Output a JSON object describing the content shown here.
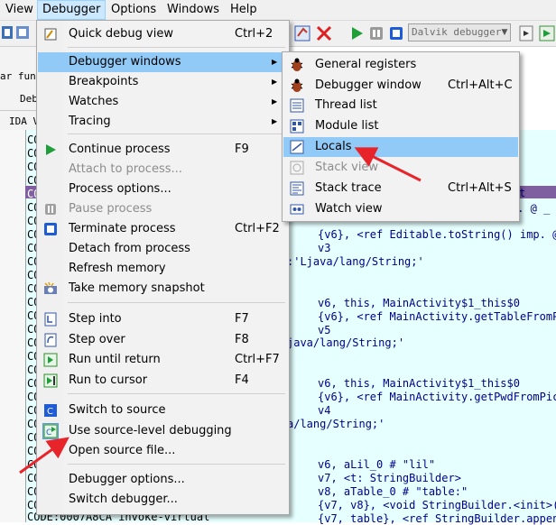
{
  "menubar": {
    "items": [
      {
        "label": "View"
      },
      {
        "label": "Debugger"
      },
      {
        "label": "Options"
      },
      {
        "label": "Windows"
      },
      {
        "label": "Help"
      }
    ]
  },
  "toolbar": {
    "debugger_select": "Dalvik debugger"
  },
  "behind": {
    "strip1": "ar fun",
    "strip2": "Deb",
    "strip3": "IDA V"
  },
  "code": {
    "lines": [
      {
        "text": "CO"
      },
      {
        "text": "CO"
      },
      {
        "text": "CO"
      },
      {
        "text": "CO"
      },
      {
        "text": "CO"
      },
      {
        "text": "CO"
      },
      {
        "text": "CO"
      },
      {
        "text": "CO"
      },
      {
        "text": "CO"
      },
      {
        "text": "CO"
      },
      {
        "text": "CO"
      },
      {
        "text": "CO"
      },
      {
        "text": "CO"
      },
      {
        "text": "CO"
      },
      {
        "text": "CO"
      },
      {
        "text": "CO"
      },
      {
        "text": "CO"
      },
      {
        "text": "CO"
      },
      {
        "text": "CO"
      },
      {
        "text": "CO"
      },
      {
        "text": "CO"
      },
      {
        "text": "CO"
      },
      {
        "text": "CO"
      },
      {
        "text": "CO"
      },
      {
        "text": "CO"
      },
      {
        "text": "CO"
      },
      {
        "text": "CO"
      },
      {
        "text": "CO"
      }
    ],
    "right": [
      {
        "text": "t"
      },
      {
        "text": "p. @ _"
      },
      {
        "text": "{v6}, <ref Editable.toString() imp. @"
      },
      {
        "text": "v3"
      },
      {
        "text": ":'Ljava/lang/String;'"
      },
      {
        "text": "v6, this, MainActivity$1_this$0"
      },
      {
        "text": "{v6}, <ref MainActivity.getTableFromPi"
      },
      {
        "text": "v5"
      },
      {
        "text": "java/lang/String;'"
      },
      {
        "text": "v6, this, MainActivity$1_this$0"
      },
      {
        "text": "{v6}, <ref MainActivity.getPwdFromPic("
      },
      {
        "text": "v4"
      },
      {
        "text": "a/lang/String;'"
      },
      {
        "text": "v6, aLil_0 # \"lil\""
      },
      {
        "text": "v7, <t: StringBuilder>"
      },
      {
        "text": "v8, aTable_0 # \"table:\""
      },
      {
        "text": "{v7, v8}, <void StringBuilder.<init>(r"
      },
      {
        "text": "{v7, table}, <ref StringBuilder.append"
      }
    ],
    "bottom_line": "CODE:0007A8CA invoke-virtual"
  },
  "debugger_menu": {
    "items": [
      {
        "label": "Quick debug view",
        "shortcut": "Ctrl+2",
        "icon": "quick-debug-icon"
      },
      {
        "label": "Debugger windows",
        "shortcut": "",
        "icon": "",
        "submenu": true
      },
      {
        "label": "Breakpoints",
        "shortcut": "",
        "submenu": true
      },
      {
        "label": "Watches",
        "shortcut": "",
        "submenu": true
      },
      {
        "label": "Tracing",
        "shortcut": "",
        "submenu": true
      },
      {
        "label": "Continue process",
        "shortcut": "F9",
        "icon": "play-icon"
      },
      {
        "label": "Attach to process...",
        "shortcut": "",
        "disabled": true
      },
      {
        "label": "Process options...",
        "shortcut": ""
      },
      {
        "label": "Pause process",
        "shortcut": "",
        "icon": "pause-icon",
        "disabled": true
      },
      {
        "label": "Terminate process",
        "shortcut": "Ctrl+F2",
        "icon": "stop-icon"
      },
      {
        "label": "Detach from process",
        "shortcut": ""
      },
      {
        "label": "Refresh memory",
        "shortcut": ""
      },
      {
        "label": "Take memory snapshot",
        "shortcut": "",
        "icon": "camera-icon"
      },
      {
        "label": "Step into",
        "shortcut": "F7",
        "icon": "step-into-icon"
      },
      {
        "label": "Step over",
        "shortcut": "F8",
        "icon": "step-over-icon"
      },
      {
        "label": "Run until return",
        "shortcut": "Ctrl+F7",
        "icon": "run-return-icon"
      },
      {
        "label": "Run to cursor",
        "shortcut": "F4",
        "icon": "run-cursor-icon"
      },
      {
        "label": "Switch to source",
        "shortcut": "",
        "icon": "switch-source-icon"
      },
      {
        "label": "Use source-level debugging",
        "shortcut": "",
        "icon": "source-debug-icon"
      },
      {
        "label": "Open source file...",
        "shortcut": ""
      },
      {
        "label": "Debugger options...",
        "shortcut": ""
      },
      {
        "label": "Switch debugger...",
        "shortcut": ""
      }
    ]
  },
  "windows_submenu": {
    "items": [
      {
        "label": "General registers",
        "shortcut": "",
        "icon": "bug-icon"
      },
      {
        "label": "Debugger window",
        "shortcut": "Ctrl+Alt+C",
        "icon": "bug-icon"
      },
      {
        "label": "Thread list",
        "shortcut": "",
        "icon": "thread-list-icon"
      },
      {
        "label": "Module list",
        "shortcut": "",
        "icon": "module-list-icon"
      },
      {
        "label": "Locals",
        "shortcut": "",
        "icon": "locals-icon"
      },
      {
        "label": "Stack view",
        "shortcut": "",
        "icon": "stack-view-icon",
        "disabled": true
      },
      {
        "label": "Stack trace",
        "shortcut": "Ctrl+Alt+S",
        "icon": "stack-trace-icon"
      },
      {
        "label": "Watch view",
        "shortcut": "",
        "icon": "watch-view-icon"
      }
    ]
  },
  "colors": {
    "highlight": "#91c9f7",
    "code_bg": "#e6ffff",
    "annotation_arrow": "#e8242b"
  }
}
